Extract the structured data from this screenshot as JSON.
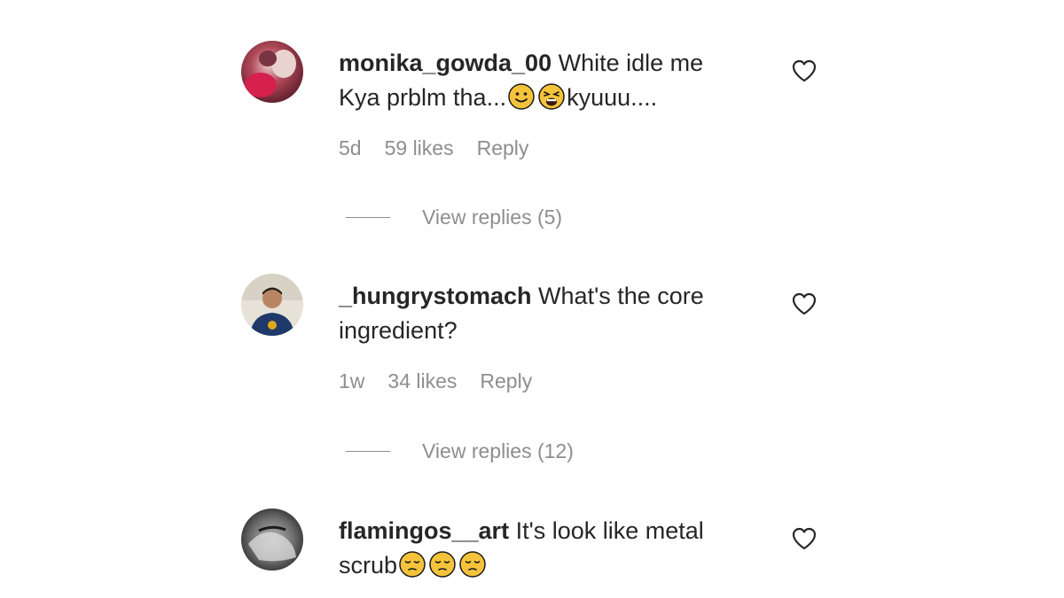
{
  "comments": [
    {
      "username": "monika_gowda_00",
      "text_before": " White idle me Kya prblm tha...",
      "emojis": [
        "slightly-smiling-face",
        "weary-face"
      ],
      "text_after": "kyuuu....",
      "time": "5d",
      "likes": "59 likes",
      "reply": "Reply",
      "view_replies": "View replies (5)"
    },
    {
      "username": "_hungrystomach",
      "text_before": " What's the core ingredient?",
      "emojis": [],
      "text_after": "",
      "time": "1w",
      "likes": "34 likes",
      "reply": "Reply",
      "view_replies": "View replies (12)"
    },
    {
      "username": "flamingos__art",
      "text_before": " It's look like metal scrub",
      "emojis": [
        "pensive-face",
        "pensive-face",
        "pensive-face"
      ],
      "text_after": ""
    }
  ],
  "colors": {
    "text": "#262626",
    "secondary": "#8e8e8e",
    "emoji_yellow": "#f5c33b"
  }
}
